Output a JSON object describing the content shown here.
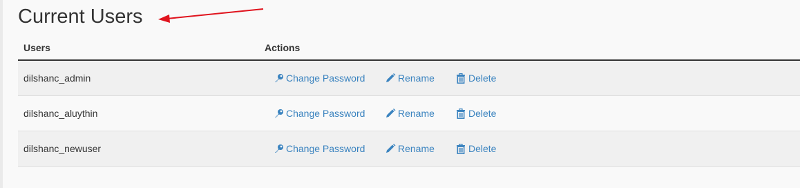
{
  "page": {
    "title": "Current Users"
  },
  "table": {
    "headers": {
      "users": "Users",
      "actions": "Actions"
    },
    "rows": [
      {
        "user": "dilshanc_admin"
      },
      {
        "user": "dilshanc_aluythin"
      },
      {
        "user": "dilshanc_newuser"
      }
    ],
    "actions": {
      "change_password": "Change Password",
      "rename": "Rename",
      "delete": "Delete"
    }
  },
  "colors": {
    "link": "#3a83bf",
    "annotation_arrow": "#e0141e",
    "header_rule": "#333333"
  },
  "icons": {
    "change_password": "key-icon",
    "rename": "pencil-icon",
    "delete": "trash-icon",
    "annotation": "red-arrow-annotation"
  }
}
